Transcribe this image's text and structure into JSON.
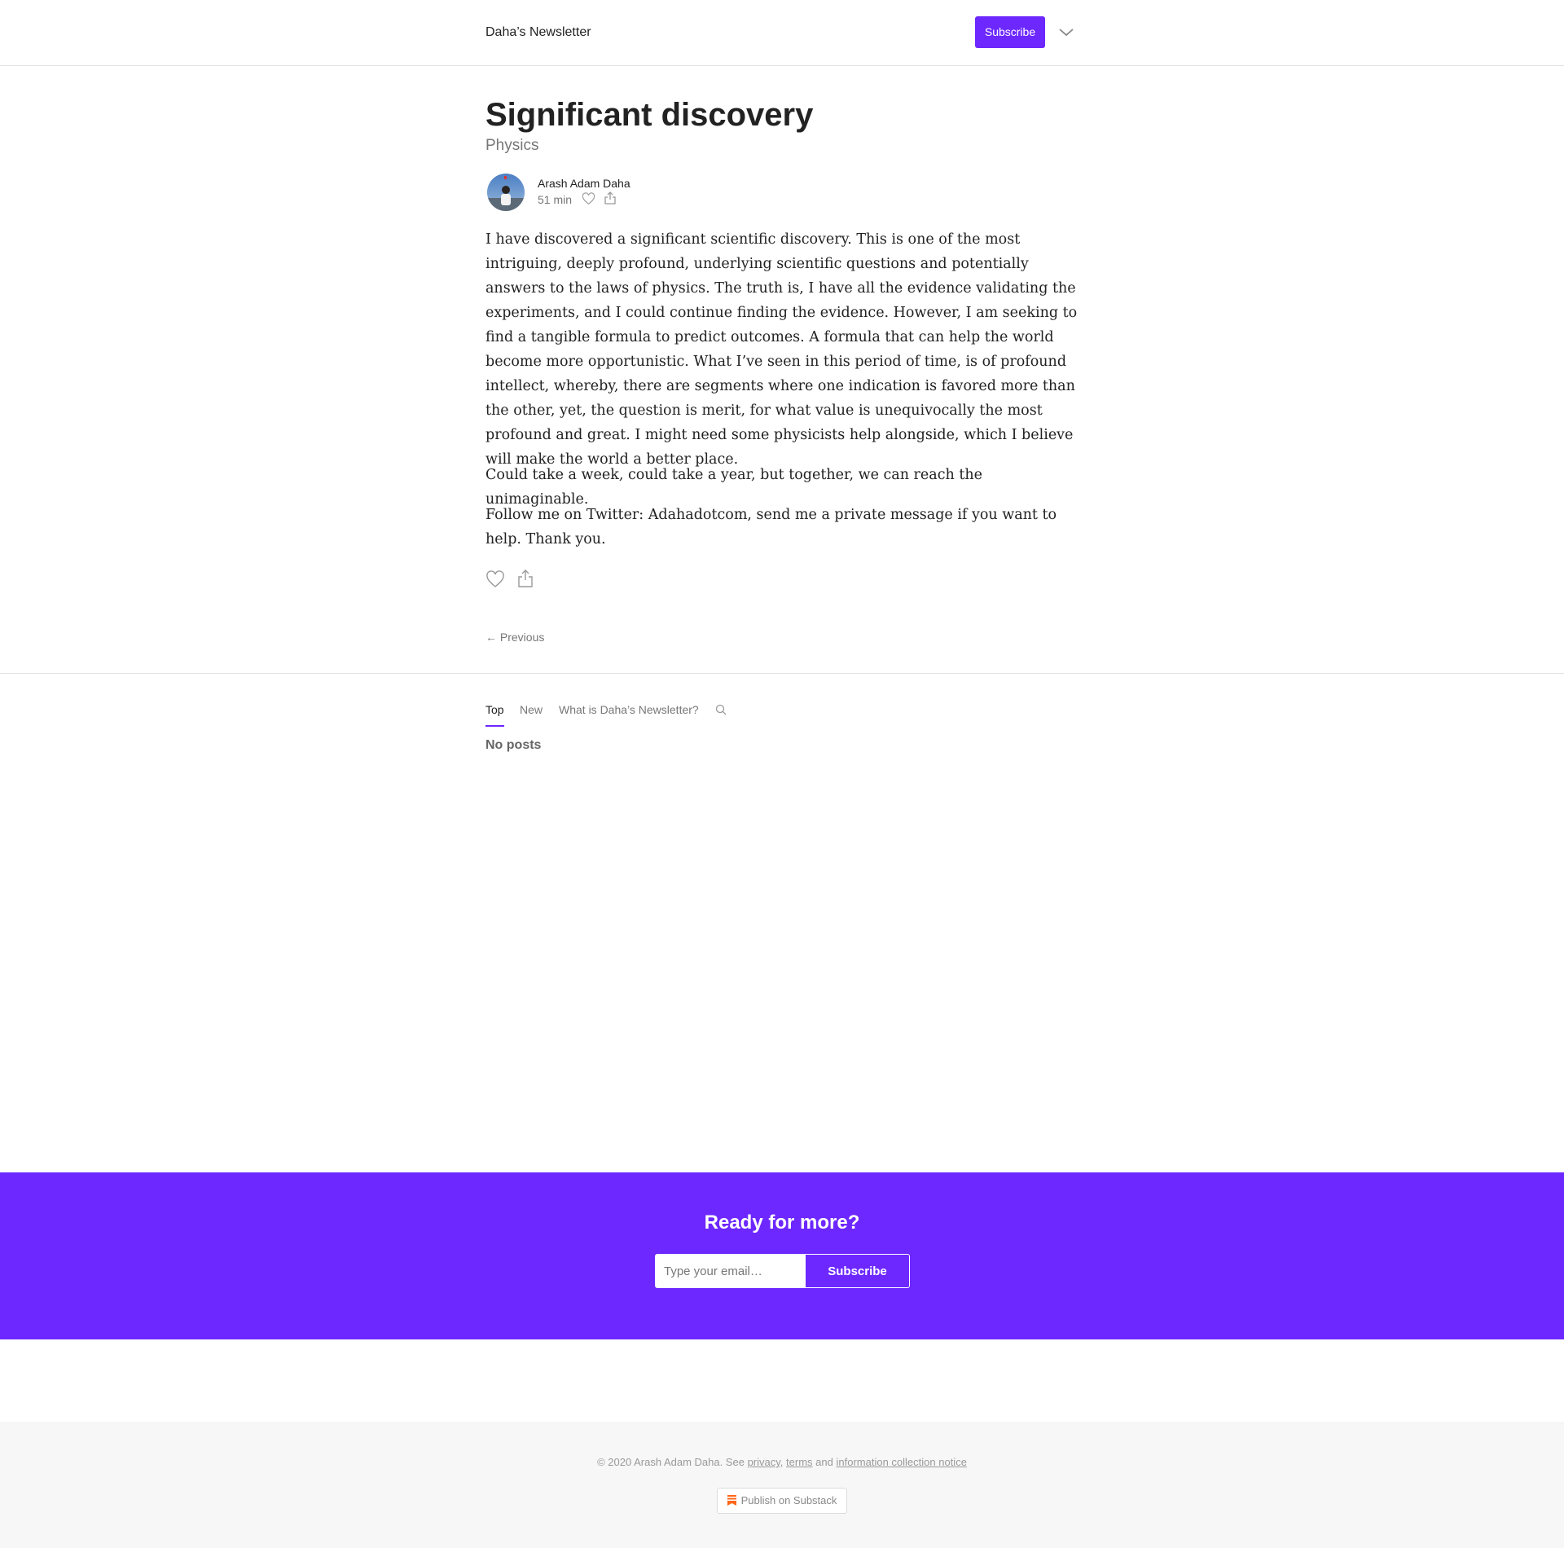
{
  "header": {
    "brand": "Daha’s Newsletter",
    "subscribe_label": "Subscribe",
    "menu_icon": "chevron-down-icon"
  },
  "post": {
    "title": "Significant discovery",
    "subtitle": "Physics",
    "author": "Arash Adam Daha",
    "read_time": "51 min",
    "paragraphs": [
      "I have discovered a significant scientific discovery. This is one of the most intriguing, deeply profound, underlying scientific questions and potentially answers to the laws of physics. The truth is, I have all the evidence validating the experiments, and I could continue finding the evidence. However, I am seeking to find a tangible formula to predict outcomes. A formula that can help the world become more opportunistic. What I’ve seen in this period of time, is of profound intellect, whereby, there are segments where one indication is favored more than the other, yet, the question is merit, for what value is unequivocally the most profound and great. I might need some physicists help alongside, which I believe will make the world a better place.",
      "Could take a week, could take a year, but together, we can reach the unimaginable.",
      "Follow me on Twitter: Adahadotcom, send me a private message if you want to help. Thank you."
    ],
    "previous_label": "← Previous"
  },
  "tabs": {
    "items": [
      "Top",
      "New",
      "What is Daha’s Newsletter?"
    ],
    "active": "Top",
    "empty_message": "No posts"
  },
  "cta": {
    "title": "Ready for more?",
    "email_placeholder": "Type your email…",
    "subscribe_label": "Subscribe"
  },
  "footer": {
    "copyright_prefix": "© 2020 Arash Adam Daha. See",
    "privacy": "privacy",
    "comma": ",",
    "terms": "terms",
    "and": "and",
    "notice": "information collection notice",
    "publish_label": "Publish on Substack"
  },
  "colors": {
    "accent": "#6d27ff",
    "footer_bg": "#f7f7f7"
  }
}
